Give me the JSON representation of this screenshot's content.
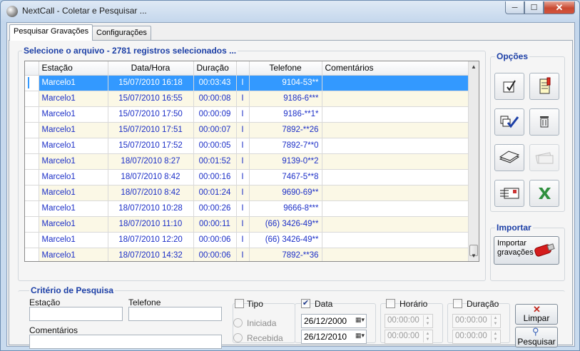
{
  "window": {
    "title": "NextCall - Coletar e Pesquisar ...",
    "minimize_glyph": "─",
    "maximize_glyph": "☐",
    "close_glyph": "✕"
  },
  "tabs": [
    {
      "label": "Pesquisar Gravações",
      "active": true
    },
    {
      "label": "Configurações",
      "active": false
    }
  ],
  "records": {
    "title": "Selecione o arquivo - 2781 registros selecionados ..."
  },
  "grid": {
    "columns": [
      "Estação",
      "Data/Hora",
      "Duração",
      "",
      "Telefone",
      "Comentários"
    ],
    "rows": [
      [
        "Marcelo1",
        "15/07/2010 16:18",
        "00:03:43",
        "I",
        "9104-53**",
        ""
      ],
      [
        "Marcelo1",
        "15/07/2010 16:55",
        "00:00:08",
        "I",
        "9186-6***",
        ""
      ],
      [
        "Marcelo1",
        "15/07/2010 17:50",
        "00:00:09",
        "I",
        "9186-**1*",
        ""
      ],
      [
        "Marcelo1",
        "15/07/2010 17:51",
        "00:00:07",
        "I",
        "7892-**26",
        ""
      ],
      [
        "Marcelo1",
        "15/07/2010 17:52",
        "00:00:05",
        "I",
        "7892-7**0",
        ""
      ],
      [
        "Marcelo1",
        "18/07/2010 8:27",
        "00:01:52",
        "I",
        "9139-0**2",
        ""
      ],
      [
        "Marcelo1",
        "18/07/2010 8:42",
        "00:00:16",
        "I",
        "7467-5**8",
        ""
      ],
      [
        "Marcelo1",
        "18/07/2010 8:42",
        "00:01:24",
        "I",
        "9690-69**",
        ""
      ],
      [
        "Marcelo1",
        "18/07/2010 10:28",
        "00:00:26",
        "I",
        "9666-8***",
        ""
      ],
      [
        "Marcelo1",
        "18/07/2010 11:10",
        "00:00:11",
        "I",
        "(66) 3426-49**",
        ""
      ],
      [
        "Marcelo1",
        "18/07/2010 12:20",
        "00:00:06",
        "I",
        "(66) 3426-49**",
        ""
      ],
      [
        "Marcelo1",
        "18/07/2010 14:32",
        "00:00:06",
        "I",
        "7892-**36",
        ""
      ]
    ],
    "selected_row": 0
  },
  "options": {
    "title": "Opções",
    "buttons": [
      "edit-note-icon",
      "notepad-icon",
      "check-all-icon",
      "trash-icon",
      "stack-icon",
      "money-icon",
      "card-icon",
      "excel-icon"
    ]
  },
  "import": {
    "title": "Importar",
    "button_line1": "Importar",
    "button_line2": "gravações"
  },
  "search": {
    "title": "Critério de Pesquisa",
    "station_label": "Estação",
    "phone_label": "Telefone",
    "comments_label": "Comentários",
    "type_label": "Tipo",
    "type_checked": false,
    "radio_initiated": "Iniciada",
    "radio_received": "Recebida",
    "date_label": "Data",
    "date_checked": true,
    "date_from": "26/12/2000",
    "date_to": "26/12/2010",
    "time_label": "Horário",
    "time_checked": false,
    "time_from": "00:00:00",
    "time_to": "00:00:00",
    "duration_label": "Duração",
    "duration_checked": false,
    "duration_from": "00:00:00",
    "duration_to": "00:00:00",
    "clear_label": "Limpar",
    "search_label": "Pesquisar"
  }
}
